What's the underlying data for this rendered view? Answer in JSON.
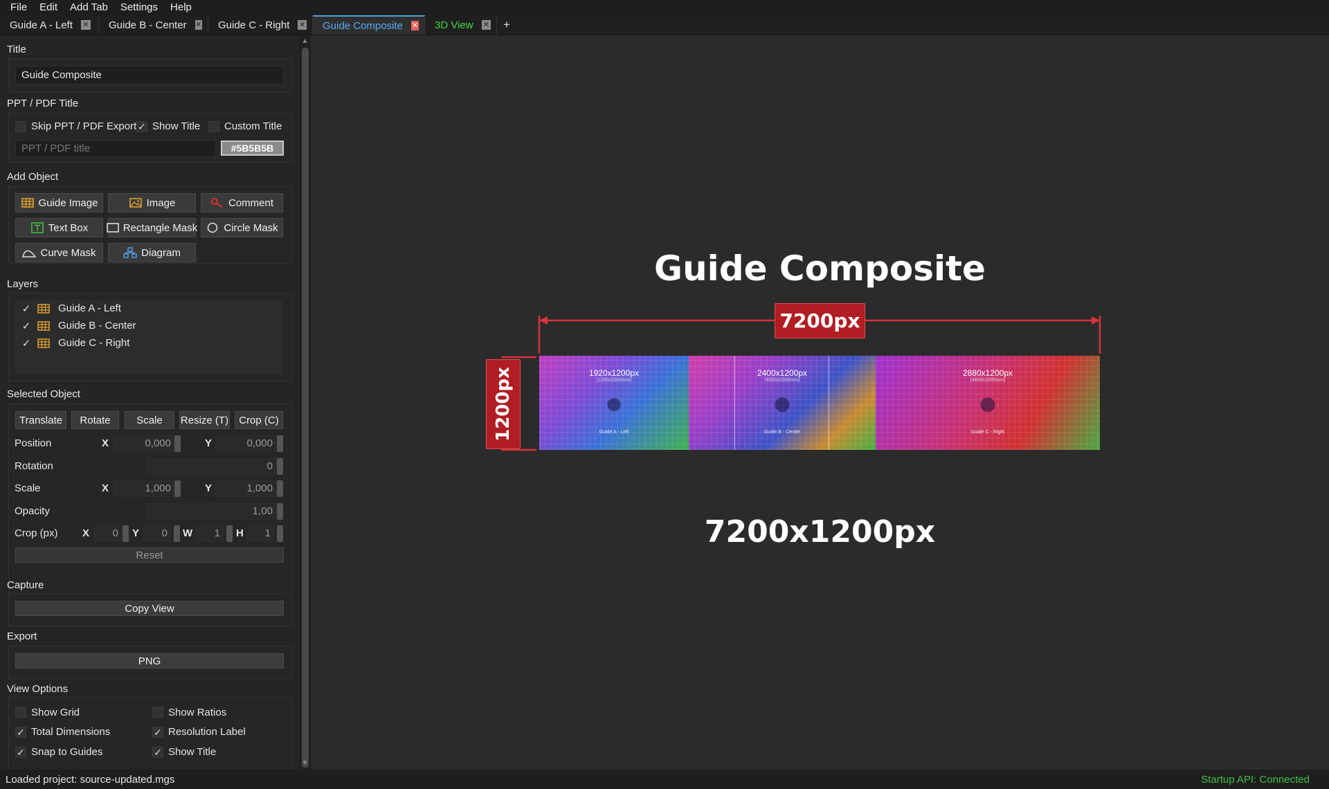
{
  "menu": [
    "File",
    "Edit",
    "Add Tab",
    "Settings",
    "Help"
  ],
  "tabs": [
    {
      "label": "Guide A - Left",
      "active": false
    },
    {
      "label": "Guide B - Center",
      "active": false
    },
    {
      "label": "Guide C - Right",
      "active": false
    },
    {
      "label": "Guide Composite",
      "active": true
    },
    {
      "label": "3D View",
      "active": false
    }
  ],
  "tab_add": "+",
  "title_section": {
    "heading": "Title",
    "value": "Guide Composite"
  },
  "ppt": {
    "heading": "PPT / PDF Title",
    "skip_label": "Skip PPT / PDF Export",
    "skip_checked": false,
    "show_title_label": "Show Title",
    "show_title_checked": true,
    "custom_title_label": "Custom Title",
    "custom_title_checked": false,
    "placeholder": "PPT / PDF title",
    "color": "#5B5B5B"
  },
  "add_object": {
    "heading": "Add Object",
    "buttons": [
      {
        "label": "Guide Image",
        "icon": "grid-icon"
      },
      {
        "label": "Image",
        "icon": "image-icon"
      },
      {
        "label": "Comment",
        "icon": "comment-icon"
      },
      {
        "label": "Text Box",
        "icon": "textbox-icon"
      },
      {
        "label": "Rectangle Mask",
        "icon": "rectangle-icon"
      },
      {
        "label": "Circle Mask",
        "icon": "circle-icon"
      },
      {
        "label": "Curve Mask",
        "icon": "curve-icon"
      },
      {
        "label": "Diagram",
        "icon": "diagram-icon"
      }
    ]
  },
  "layers": {
    "heading": "Layers",
    "items": [
      {
        "label": "Guide A - Left",
        "checked": true
      },
      {
        "label": "Guide B - Center",
        "checked": true
      },
      {
        "label": "Guide C - Right",
        "checked": true
      }
    ]
  },
  "selected_object": {
    "heading": "Selected Object",
    "tools": [
      "Translate",
      "Rotate",
      "Scale",
      "Resize (T)",
      "Crop (C)"
    ],
    "position_label": "Position",
    "position": {
      "x": "0,000",
      "y": "0,000"
    },
    "rotation_label": "Rotation",
    "rotation": "0",
    "scale_label": "Scale",
    "scale": {
      "x": "1,000",
      "y": "1,000"
    },
    "opacity_label": "Opacity",
    "opacity": "1,00",
    "crop_label": "Crop (px)",
    "crop": {
      "x": "0",
      "y": "0",
      "w": "1",
      "h": "1"
    },
    "axis_x": "X",
    "axis_y": "Y",
    "axis_w": "W",
    "axis_h": "H",
    "reset": "Reset"
  },
  "capture": {
    "heading": "Capture",
    "button": "Copy View"
  },
  "export": {
    "heading": "Export",
    "button": "PNG"
  },
  "view_options": {
    "heading": "View Options",
    "items": [
      {
        "label": "Show Grid",
        "checked": false
      },
      {
        "label": "Show Ratios",
        "checked": false
      },
      {
        "label": "Total Dimensions",
        "checked": true
      },
      {
        "label": "Resolution Label",
        "checked": true
      },
      {
        "label": "Snap to Guides",
        "checked": true
      },
      {
        "label": "Show Title",
        "checked": true
      }
    ]
  },
  "canvas": {
    "title": "Guide Composite",
    "width_label": "7200px",
    "height_label": "1200px",
    "resolution": "7200x1200px",
    "images": [
      {
        "res": "1920x1200px",
        "sub": "(1200x2000mm)",
        "name": "Guide A - Left"
      },
      {
        "res": "2400x1200px",
        "sub": "(4000x2000mm)",
        "name": "Guide B - Center"
      },
      {
        "res": "2880x1200px",
        "sub": "(4800x2000mm)",
        "name": "Guide C - Right"
      }
    ]
  },
  "status": {
    "left": "Loaded project: source-updated.mgs",
    "right": "Startup API: Connected"
  },
  "colors": {
    "accent": "#4fa3d9",
    "dimension_red": "#b01e24",
    "status_green": "#3fbf3f"
  }
}
